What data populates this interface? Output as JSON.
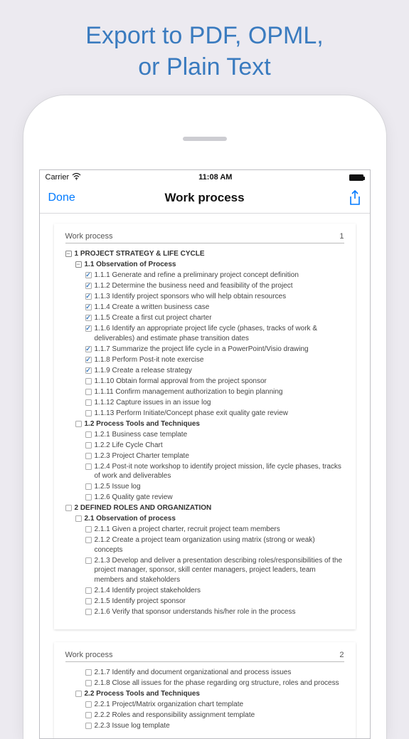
{
  "promo": {
    "line1": "Export to PDF, OPML,",
    "line2": "or Plain Text"
  },
  "statusbar": {
    "carrier": "Carrier",
    "time": "11:08 AM"
  },
  "navbar": {
    "done": "Done",
    "title": "Work process"
  },
  "pages": [
    {
      "header": "Work process",
      "number": "1"
    },
    {
      "header": "Work process",
      "number": "2"
    }
  ],
  "outline1": [
    {
      "indent": 0,
      "bold": true,
      "box": "minus",
      "text": "1 PROJECT STRATEGY & LIFE CYCLE"
    },
    {
      "indent": 1,
      "bold": true,
      "box": "minus",
      "text": "1.1 Observation of Process"
    },
    {
      "indent": 2,
      "bold": false,
      "box": "checked",
      "text": "1.1.1 Generate and refine a preliminary project concept definition"
    },
    {
      "indent": 2,
      "bold": false,
      "box": "checked",
      "text": "1.1.2 Determine the business need and feasibility of the project"
    },
    {
      "indent": 2,
      "bold": false,
      "box": "checked",
      "text": "1.1.3 Identify project sponsors who will help obtain resources"
    },
    {
      "indent": 2,
      "bold": false,
      "box": "checked",
      "text": "1.1.4 Create a written business case"
    },
    {
      "indent": 2,
      "bold": false,
      "box": "checked",
      "text": "1.1.5 Create a first cut project charter"
    },
    {
      "indent": 2,
      "bold": false,
      "box": "checked",
      "text": "1.1.6 Identify an appropriate project life cycle (phases, tracks of work & deliverables) and estimate phase transition dates"
    },
    {
      "indent": 2,
      "bold": false,
      "box": "checked",
      "text": "1.1.7 Summarize the project life cycle in a PowerPoint/Visio drawing"
    },
    {
      "indent": 2,
      "bold": false,
      "box": "checked",
      "text": "1.1.8 Perform Post-it note exercise"
    },
    {
      "indent": 2,
      "bold": false,
      "box": "checked",
      "text": "1.1.9 Create a release strategy"
    },
    {
      "indent": 2,
      "bold": false,
      "box": "empty",
      "text": "1.1.10 Obtain formal approval from the project sponsor"
    },
    {
      "indent": 2,
      "bold": false,
      "box": "empty",
      "text": "1.1.11 Confirm management authorization to begin planning"
    },
    {
      "indent": 2,
      "bold": false,
      "box": "empty",
      "text": "1.1.12 Capture issues in an issue log"
    },
    {
      "indent": 2,
      "bold": false,
      "box": "empty",
      "text": "1.1.13 Perform Initiate/Concept phase exit quality gate review"
    },
    {
      "indent": 1,
      "bold": true,
      "box": "empty",
      "text": "1.2 Process Tools and Techniques"
    },
    {
      "indent": 2,
      "bold": false,
      "box": "empty",
      "text": "1.2.1 Business case template"
    },
    {
      "indent": 2,
      "bold": false,
      "box": "empty",
      "text": "1.2.2 Life Cycle Chart"
    },
    {
      "indent": 2,
      "bold": false,
      "box": "empty",
      "text": "1.2.3 Project Charter template"
    },
    {
      "indent": 2,
      "bold": false,
      "box": "empty",
      "text": "1.2.4 Post-it note workshop to identify project mission, life cycle phases, tracks of work and deliverables"
    },
    {
      "indent": 2,
      "bold": false,
      "box": "empty",
      "text": "1.2.5 Issue log"
    },
    {
      "indent": 2,
      "bold": false,
      "box": "empty",
      "text": "1.2.6 Quality gate review"
    },
    {
      "indent": 0,
      "bold": true,
      "box": "empty",
      "text": "2 DEFINED ROLES AND ORGANIZATION"
    },
    {
      "indent": 1,
      "bold": true,
      "box": "empty",
      "text": "2.1 Observation of process"
    },
    {
      "indent": 2,
      "bold": false,
      "box": "empty",
      "text": "2.1.1 Given a project charter, recruit project team members"
    },
    {
      "indent": 2,
      "bold": false,
      "box": "empty",
      "text": "2.1.2 Create a project team organization using matrix (strong or weak) concepts"
    },
    {
      "indent": 2,
      "bold": false,
      "box": "empty",
      "text": "2.1.3 Develop and deliver a presentation describing roles/responsibilities of the project manager, sponsor, skill center managers, project leaders, team members and stakeholders"
    },
    {
      "indent": 2,
      "bold": false,
      "box": "empty",
      "text": "2.1.4 Identify project stakeholders"
    },
    {
      "indent": 2,
      "bold": false,
      "box": "empty",
      "text": "2.1.5 Identify project sponsor"
    },
    {
      "indent": 2,
      "bold": false,
      "box": "empty",
      "text": "2.1.6 Verify that sponsor understands his/her role in the process"
    }
  ],
  "outline2": [
    {
      "indent": 2,
      "bold": false,
      "box": "empty",
      "text": "2.1.7 Identify and document organizational and process issues"
    },
    {
      "indent": 2,
      "bold": false,
      "box": "empty",
      "text": "2.1.8 Close all issues for the phase regarding org structure, roles and process"
    },
    {
      "indent": 1,
      "bold": true,
      "box": "empty",
      "text": "2.2 Process Tools and Techniques"
    },
    {
      "indent": 2,
      "bold": false,
      "box": "empty",
      "text": "2.2.1 Project/Matrix organization chart template"
    },
    {
      "indent": 2,
      "bold": false,
      "box": "empty",
      "text": "2.2.2 Roles and responsibility assignment template"
    },
    {
      "indent": 2,
      "bold": false,
      "box": "empty",
      "text": "2.2.3 Issue log template"
    }
  ]
}
